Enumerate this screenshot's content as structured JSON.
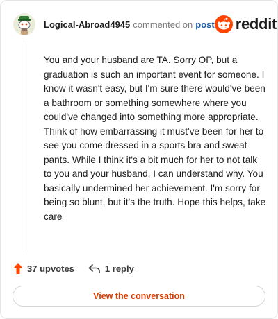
{
  "header": {
    "username": "Logical-Abroad4945",
    "commented_text": "commented on",
    "post_link": "post",
    "brand_name": "reddit",
    "avatar_icon": "snoo-avatar-icon",
    "brand_icon": "reddit-snoo-icon"
  },
  "comment": {
    "body": "You and your husband are TA. Sorry OP, but a graduation is such an important event for someone. I know it wasn't easy, but I'm sure there would've been a bathroom or something somewhere where you could've changed into something more appropriate. Think of how embarrassing it must've been for her to see you come dressed in a sports bra and sweat pants. While I think it's a bit much for her to not talk to you and your husband, I can understand why. You basically undermined her achievement. I'm sorry for being so blunt, but it's the truth. Hope this helps, take care"
  },
  "actions": {
    "upvotes_label": "37 upvotes",
    "reply_label": "1 reply",
    "upvote_icon": "upvote-arrow-icon",
    "reply_icon": "reply-arrow-icon"
  },
  "cta": {
    "view_label": "View the conversation"
  },
  "colors": {
    "accent": "#ff4500",
    "link": "#1f5faa",
    "cta_text": "#d93a00",
    "muted": "#7c7c7c"
  }
}
